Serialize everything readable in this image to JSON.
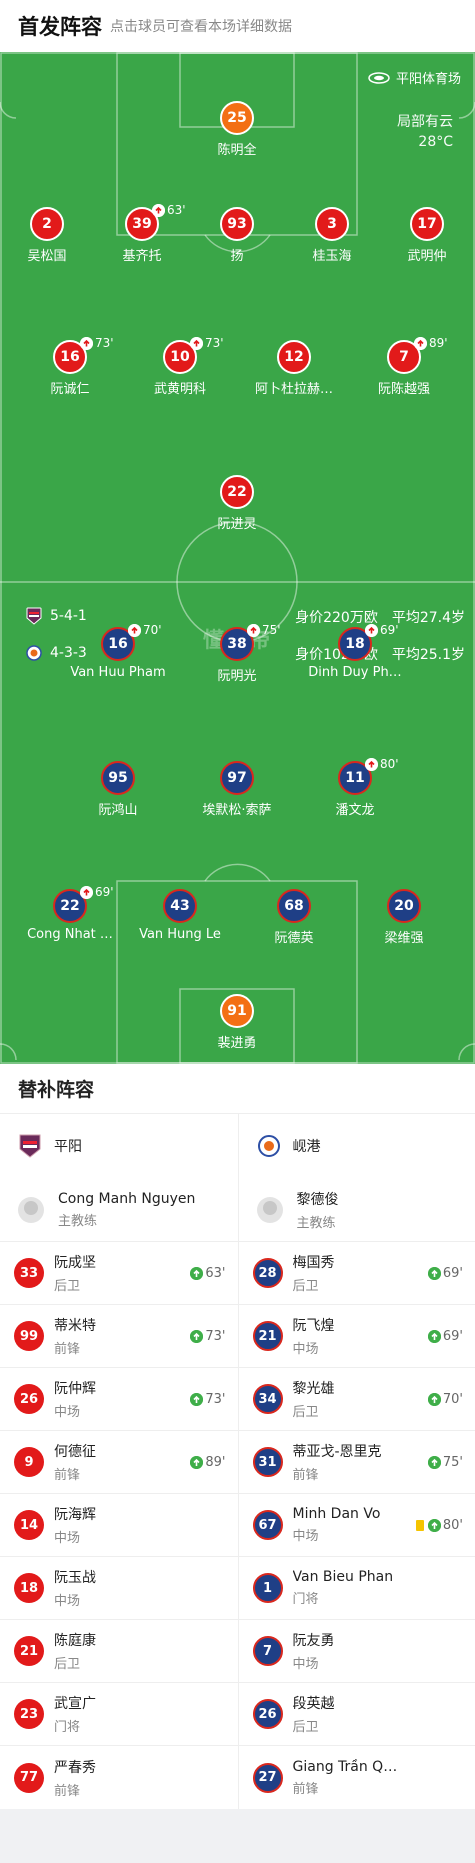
{
  "header": {
    "title": "首发阵容",
    "subtitle": "点击球员可查看本场详细数据"
  },
  "pitch": {
    "venue": "平阳体育场",
    "weather": "局部有云",
    "temperature": "28°C",
    "watermark": "懂球帝",
    "home": {
      "formation": "5-4-1",
      "value": "身价220万欧",
      "avg_age": "平均27.4岁"
    },
    "away": {
      "formation": "4-3-3",
      "value": "身价102万欧",
      "avg_age": "平均25.1岁"
    },
    "players": [
      {
        "id": "p1",
        "num": "25",
        "name": "陈明全",
        "kind": "gk"
      },
      {
        "id": "p2",
        "num": "2",
        "name": "吴松国",
        "kind": "red"
      },
      {
        "id": "p3",
        "num": "39",
        "name": "基齐托",
        "kind": "red",
        "sub": "63'"
      },
      {
        "id": "p4",
        "num": "93",
        "name": "扬",
        "kind": "red"
      },
      {
        "id": "p5",
        "num": "3",
        "name": "桂玉海",
        "kind": "red"
      },
      {
        "id": "p6",
        "num": "17",
        "name": "武明仲",
        "kind": "red"
      },
      {
        "id": "p7",
        "num": "16",
        "name": "阮诚仁",
        "kind": "red",
        "sub": "73'"
      },
      {
        "id": "p8",
        "num": "10",
        "name": "武黄明科",
        "kind": "red",
        "sub": "73'"
      },
      {
        "id": "p9",
        "num": "12",
        "name": "阿卜杜拉赫…",
        "kind": "red"
      },
      {
        "id": "p10",
        "num": "7",
        "name": "阮陈越强",
        "kind": "red",
        "sub": "89'"
      },
      {
        "id": "p11",
        "num": "22",
        "name": "阮进灵",
        "kind": "red",
        "goal": true
      },
      {
        "id": "a1",
        "num": "16",
        "name": "Van Huu Pham",
        "kind": "blue",
        "sub": "70'"
      },
      {
        "id": "a2",
        "num": "38",
        "name": "阮明光",
        "kind": "blue",
        "sub": "75'",
        "goal": true
      },
      {
        "id": "a3",
        "num": "18",
        "name": "Dinh Duy Ph…",
        "kind": "blue",
        "sub": "69'"
      },
      {
        "id": "a4",
        "num": "95",
        "name": "阮鸿山",
        "kind": "blue",
        "card": true
      },
      {
        "id": "a5",
        "num": "97",
        "name": "埃默松·索萨",
        "kind": "blue"
      },
      {
        "id": "a6",
        "num": "11",
        "name": "潘文龙",
        "kind": "blue",
        "sub": "80'"
      },
      {
        "id": "a7",
        "num": "22",
        "name": "Cong Nhat …",
        "kind": "blue",
        "sub": "69'"
      },
      {
        "id": "a8",
        "num": "43",
        "name": "Van Hung Le",
        "kind": "blue"
      },
      {
        "id": "a9",
        "num": "68",
        "name": "阮德英",
        "kind": "blue"
      },
      {
        "id": "a10",
        "num": "20",
        "name": "梁维强",
        "kind": "blue"
      },
      {
        "id": "a11",
        "num": "91",
        "name": "裴进勇",
        "kind": "gk"
      }
    ]
  },
  "subs": {
    "title": "替补阵容",
    "coach_label": "主教练",
    "home": {
      "team": "平阳",
      "coach": "Cong Manh Nguyen",
      "players": [
        {
          "num": "33",
          "name": "阮成坚",
          "pos": "后卫",
          "sub": "63'"
        },
        {
          "num": "99",
          "name": "蒂米特",
          "pos": "前锋",
          "sub": "73'"
        },
        {
          "num": "26",
          "name": "阮仲辉",
          "pos": "中场",
          "sub": "73'"
        },
        {
          "num": "9",
          "name": "何德征",
          "pos": "前锋",
          "sub": "89'"
        },
        {
          "num": "14",
          "name": "阮海辉",
          "pos": "中场"
        },
        {
          "num": "18",
          "name": "阮玉战",
          "pos": "中场"
        },
        {
          "num": "21",
          "name": "陈庭康",
          "pos": "后卫"
        },
        {
          "num": "23",
          "name": "武宣广",
          "pos": "门将"
        },
        {
          "num": "77",
          "name": "严春秀",
          "pos": "前锋"
        }
      ]
    },
    "away": {
      "team": "岘港",
      "coach": "黎德俊",
      "players": [
        {
          "num": "28",
          "name": "梅国秀",
          "pos": "后卫",
          "sub": "69'"
        },
        {
          "num": "21",
          "name": "阮飞煌",
          "pos": "中场",
          "sub": "69'"
        },
        {
          "num": "34",
          "name": "黎光雄",
          "pos": "后卫",
          "sub": "70'"
        },
        {
          "num": "31",
          "name": "蒂亚戈-恩里克",
          "pos": "前锋",
          "sub": "75'"
        },
        {
          "num": "67",
          "name": "Minh Dan Vo",
          "pos": "中场",
          "sub": "80'",
          "card": true
        },
        {
          "num": "1",
          "name": "Van Bieu Phan",
          "pos": "门将"
        },
        {
          "num": "7",
          "name": "阮友勇",
          "pos": "中场"
        },
        {
          "num": "26",
          "name": "段英越",
          "pos": "后卫"
        },
        {
          "num": "27",
          "name": "Giang Trần Q…",
          "pos": "前锋"
        }
      ]
    }
  }
}
